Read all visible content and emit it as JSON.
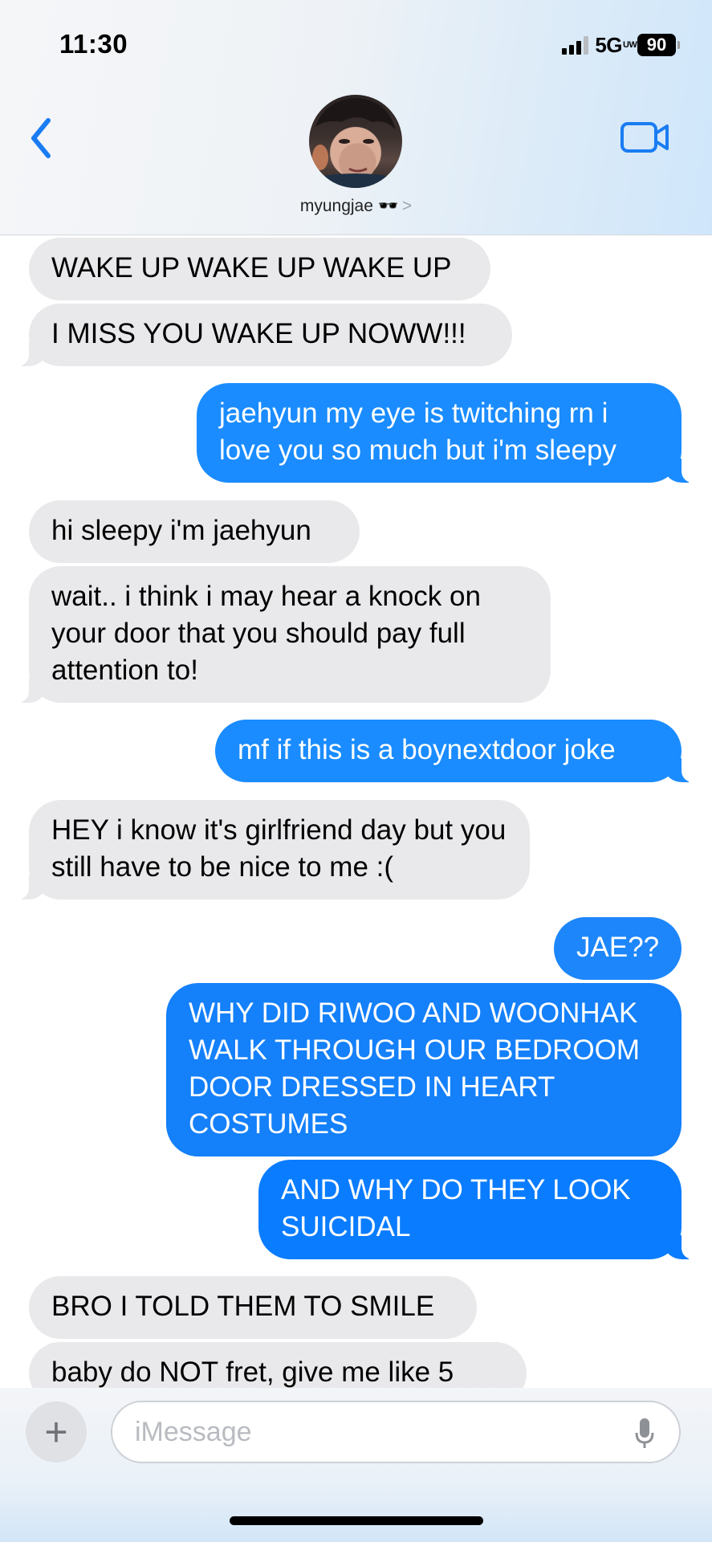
{
  "status_bar": {
    "time": "11:30",
    "network": "5G",
    "network_badge": "UW",
    "battery": "90"
  },
  "header": {
    "contact_name": "myungjae 🕶️",
    "chevron": ">",
    "back_icon": "chevron-left-icon",
    "video_icon": "video-camera-icon"
  },
  "messages": [
    {
      "from": "them",
      "text": "WAKE UP WAKE UP WAKE UP"
    },
    {
      "from": "them",
      "text": "I MISS YOU WAKE UP NOWW!!!"
    },
    {
      "from": "me",
      "text": "jaehyun my eye is twitching rn i love you so much but i'm sleepy"
    },
    {
      "from": "them",
      "text": "hi sleepy i'm jaehyun"
    },
    {
      "from": "them",
      "text": "wait.. i think i may hear a knock on your door that you should pay full attention to!"
    },
    {
      "from": "me",
      "text": "mf if this is a boynextdoor joke"
    },
    {
      "from": "them",
      "text": "HEY i know it's girlfriend day but you still have to be nice to me :("
    },
    {
      "from": "me",
      "text": "JAE??"
    },
    {
      "from": "me",
      "text": "WHY DID RIWOO AND WOONHAK WALK THROUGH OUR BEDROOM DOOR DRESSED IN HEART COSTUMES"
    },
    {
      "from": "me",
      "text": "AND WHY DO THEY LOOK SUICIDAL"
    },
    {
      "from": "them",
      "text": "BRO I TOLD THEM TO SMILE"
    },
    {
      "from": "them",
      "text": "baby do NOT fret, give me like 5"
    }
  ],
  "composer": {
    "add_label": "+",
    "placeholder": "iMessage"
  },
  "colors": {
    "sent_bubble": "#1a8cff",
    "sent_bubble_dark": "#0a7cff",
    "received_bubble": "#e9e9eb",
    "accent": "#1a7cf2"
  }
}
